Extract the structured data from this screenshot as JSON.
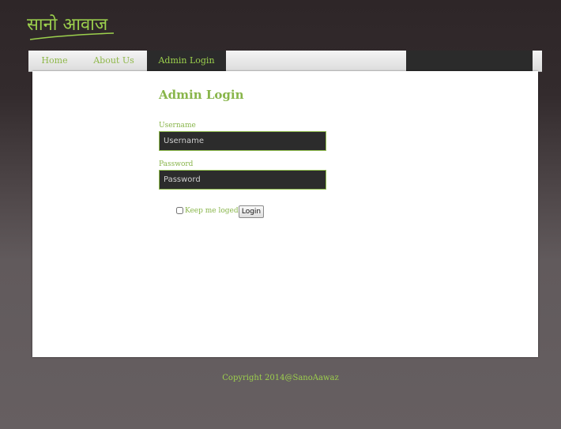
{
  "brand": {
    "logo_text": "सानो आवाज",
    "logo_color": "#9cd04d",
    "logo_icon": "sano-aawaz-logo"
  },
  "nav": {
    "items": [
      {
        "label": "Home"
      },
      {
        "label": "About Us"
      },
      {
        "label": "Admin Login",
        "active": true
      }
    ]
  },
  "page": {
    "title": "Admin Login"
  },
  "form": {
    "username_label": "Username",
    "username_placeholder": "Username",
    "username_value": "",
    "password_label": "Password",
    "password_placeholder": "Password",
    "password_value": "",
    "remember_label": "Keep me loged in",
    "remember_checked": false,
    "submit_label": "Login"
  },
  "footer": {
    "copyright": "Copyright 2014@SanoAawaz"
  },
  "colors": {
    "accent": "#88b54a",
    "nav_active_bg": "#2b2b2b",
    "input_bg": "#2c2c2c"
  }
}
